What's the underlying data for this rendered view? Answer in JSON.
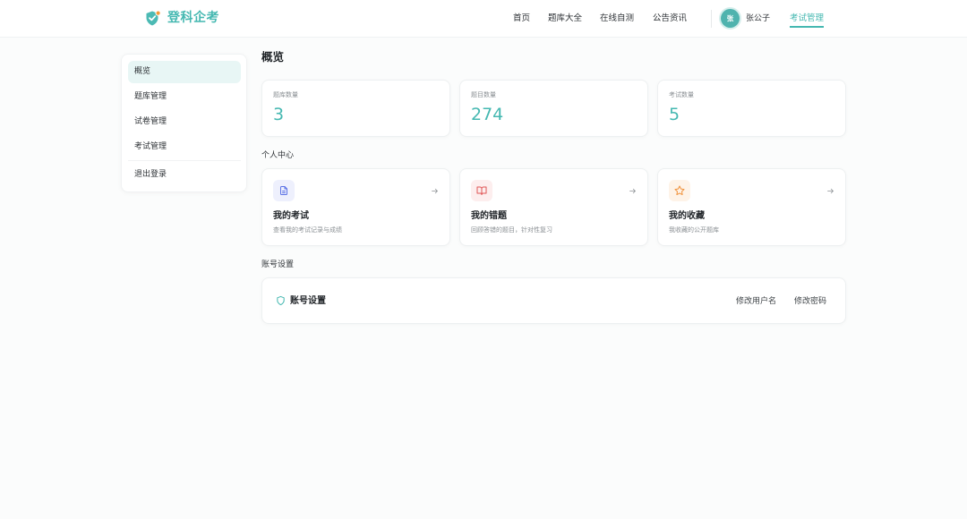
{
  "header": {
    "brand": "登科企考",
    "logo_icon": "shield-check-icon",
    "nav": [
      {
        "label": "首页"
      },
      {
        "label": "题库大全"
      },
      {
        "label": "在线自测"
      },
      {
        "label": "公告资讯"
      }
    ],
    "user": {
      "avatar_text": "张",
      "name": "张公子"
    },
    "manage_link": {
      "label": "考试管理",
      "active": true
    }
  },
  "sidebar": {
    "items": [
      {
        "label": "概览",
        "active": true
      },
      {
        "label": "题库管理",
        "active": false
      },
      {
        "label": "试卷管理",
        "active": false
      },
      {
        "label": "考试管理",
        "active": false
      },
      {
        "label": "退出登录",
        "active": false
      }
    ]
  },
  "main": {
    "title": "概览",
    "stats": [
      {
        "label": "题库数量",
        "value": "3"
      },
      {
        "label": "题目数量",
        "value": "274"
      },
      {
        "label": "考试数量",
        "value": "5"
      }
    ],
    "personal": {
      "heading": "个人中心",
      "cards": [
        {
          "title": "我的考试",
          "desc": "查看我的考试记录与成绩",
          "icon": "document-icon",
          "color": "#5b72e6",
          "bg": "#eef0fd"
        },
        {
          "title": "我的错题",
          "desc": "回顾答错的题目，针对性复习",
          "icon": "book-open-icon",
          "color": "#e05555",
          "bg": "#fdeeee"
        },
        {
          "title": "我的收藏",
          "desc": "我收藏的公开题库",
          "icon": "star-icon",
          "color": "#f0923c",
          "bg": "#fef3e8"
        }
      ]
    },
    "account": {
      "heading": "账号设置",
      "title": "账号设置",
      "icon": "shield-icon",
      "actions": [
        {
          "label": "修改用户名"
        },
        {
          "label": "修改密码"
        }
      ]
    }
  },
  "colors": {
    "accent": "#45b8b1",
    "page_bg": "#fbfcfc",
    "active_bg": "#e8f6f5"
  }
}
